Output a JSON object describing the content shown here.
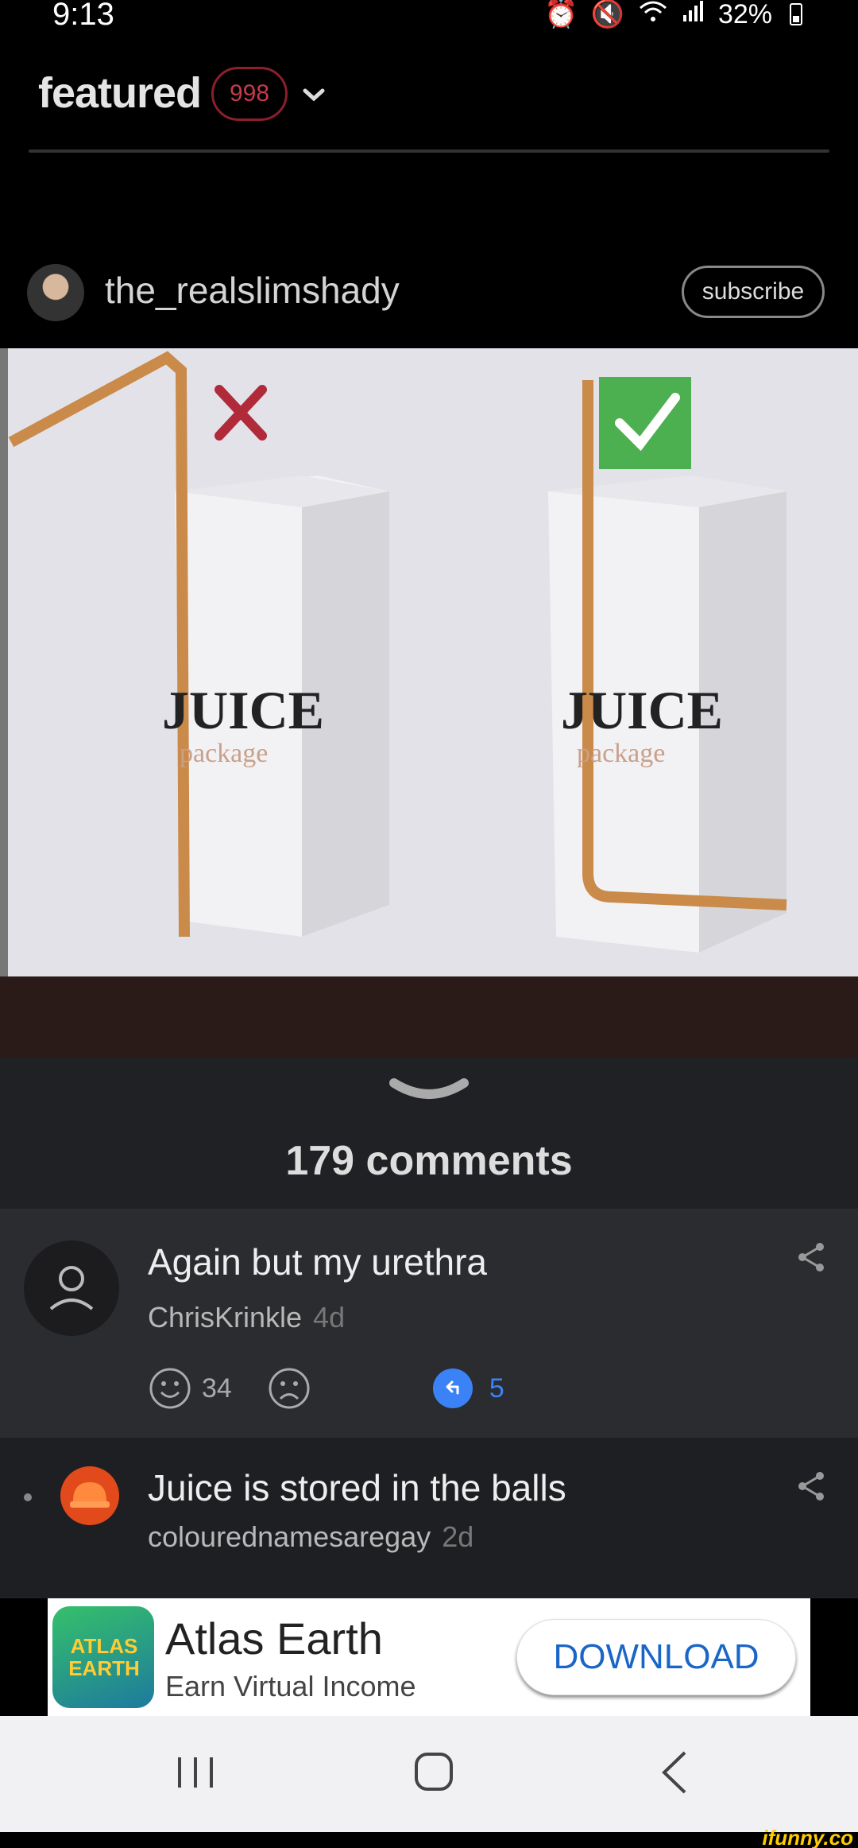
{
  "status_bar": {
    "time": "9:13",
    "battery": "32%",
    "icons": [
      "alarm-icon",
      "mute-icon",
      "wifi-icon",
      "signal-icon",
      "battery-icon"
    ]
  },
  "header": {
    "title": "featured",
    "badge": "998"
  },
  "post": {
    "author": "the_realslimshady",
    "subscribe_label": "subscribe",
    "image_text": {
      "left_brand": "JUICE",
      "left_sub": "package",
      "right_brand": "JUICE",
      "right_sub": "package"
    }
  },
  "comments": {
    "count_label": "179 comments",
    "items": [
      {
        "text": "Again but my urethra",
        "user": "ChrisKrinkle",
        "time": "4d",
        "smile_count": "34",
        "replies": "5"
      },
      {
        "text": "Juice is stored in the balls",
        "user": "colourednamesaregay",
        "time": "2d"
      }
    ]
  },
  "ad": {
    "logo_text": "ATLAS EARTH",
    "title": "Atlas Earth",
    "subtitle": "Earn Virtual Income",
    "button": "DOWNLOAD"
  },
  "watermark": "ifunny.co",
  "colors": {
    "badge_border": "#8c1f2b",
    "reply_blue": "#3b82f6",
    "panel_bg": "#202124",
    "download_blue": "#1a66c8"
  }
}
